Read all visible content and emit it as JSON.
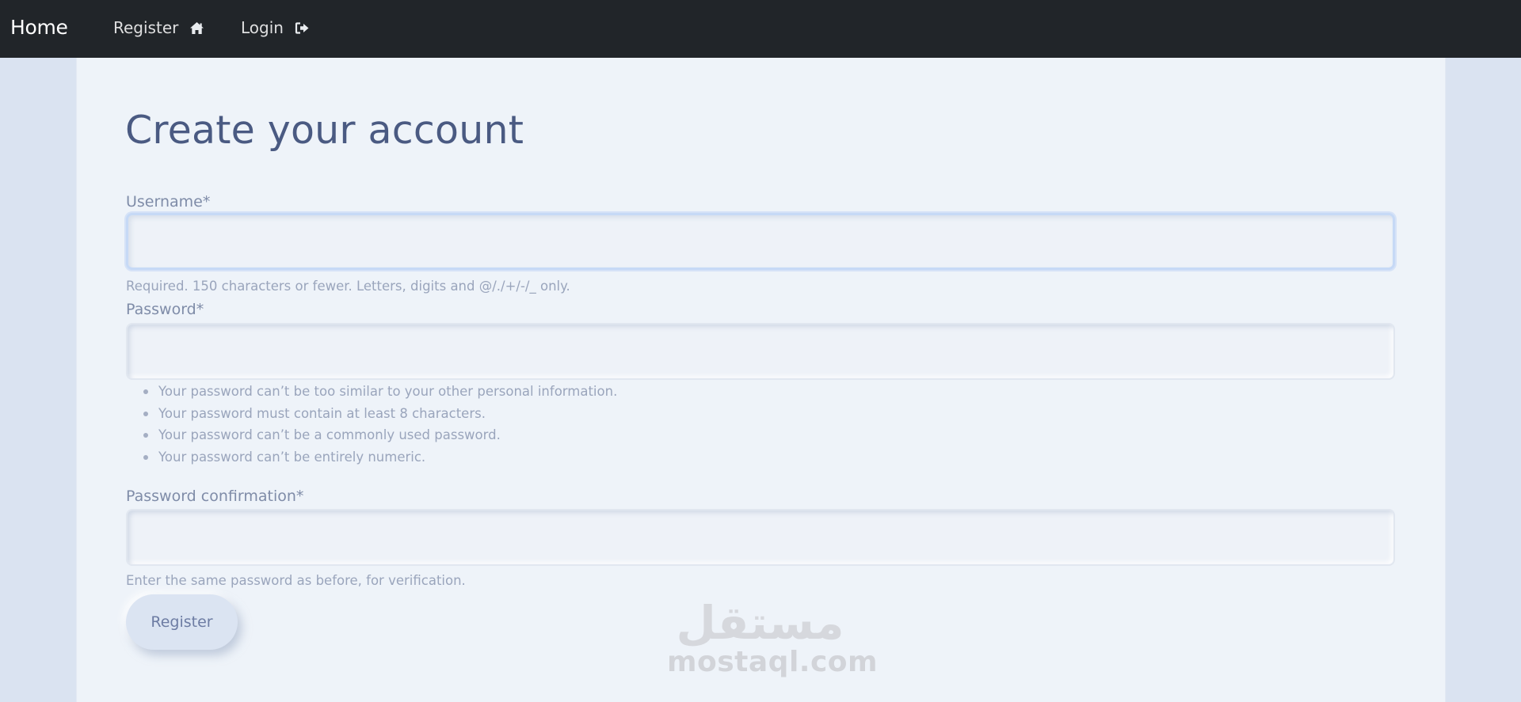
{
  "navbar": {
    "brand": "Home",
    "links": [
      {
        "label": "Register",
        "icon": "home-icon"
      },
      {
        "label": "Login",
        "icon": "sign-out-icon"
      }
    ]
  },
  "form": {
    "title": "Create your account",
    "fields": [
      {
        "label": "Username*",
        "value": "",
        "help": "Required. 150 characters or fewer. Letters, digits and @/./+/-/_ only."
      },
      {
        "label": "Password*",
        "value": "",
        "rules": [
          "Your password can’t be too similar to your other personal information.",
          "Your password must contain at least 8 characters.",
          "Your password can’t be a commonly used password.",
          "Your password can’t be entirely numeric."
        ]
      },
      {
        "label": "Password confirmation*",
        "value": "",
        "help": "Enter the same password as before, for verification."
      }
    ],
    "submit_label": "Register"
  },
  "watermark": {
    "arabic": "مستقل",
    "latin": "mostaql.com"
  }
}
